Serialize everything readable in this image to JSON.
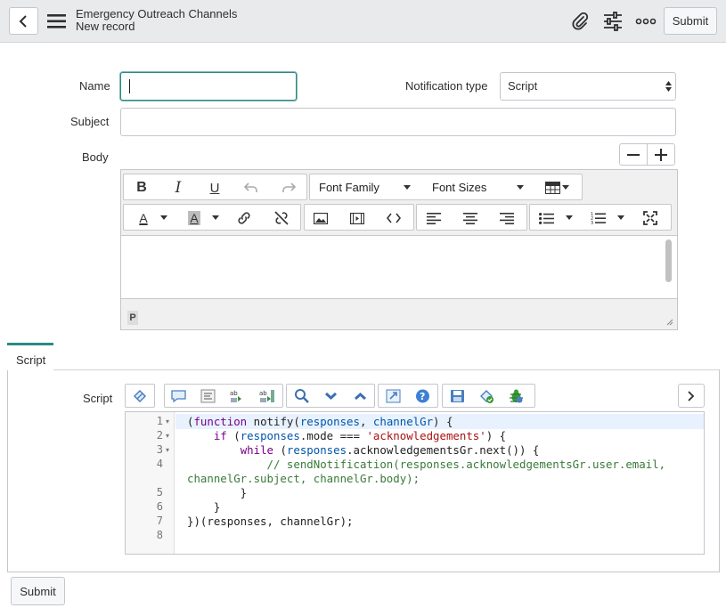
{
  "header": {
    "back_icon": "chevron-left-icon",
    "menu_icon": "hamburger-icon",
    "title": "Emergency Outreach Channels",
    "subtitle": "New record",
    "icons": [
      "paperclip-icon",
      "sliders-icon",
      "more-icon"
    ],
    "submit_label": "Submit"
  },
  "form": {
    "name_label": "Name",
    "name_value": "",
    "notification_type_label": "Notification type",
    "notification_type_value": "Script",
    "subject_label": "Subject",
    "subject_value": "",
    "body_label": "Body",
    "collapse_symbol": "−",
    "expand_symbol": "+"
  },
  "editor": {
    "font_family_label": "Font Family",
    "font_sizes_label": "Font Sizes",
    "path_element": "P",
    "content": ""
  },
  "script_section": {
    "tab_label": "Script",
    "field_label": "Script",
    "code_lines": [
      {
        "num": "1",
        "fold": true
      },
      {
        "num": "2",
        "fold": true
      },
      {
        "num": "3",
        "fold": true
      },
      {
        "num": "4",
        "fold": false
      },
      {
        "num": "5",
        "fold": false
      },
      {
        "num": "6",
        "fold": false
      },
      {
        "num": "7",
        "fold": false
      },
      {
        "num": "8",
        "fold": false
      }
    ],
    "code": {
      "l1a": "(",
      "l1kw": "function",
      "l1b": " notify(",
      "l1v1": "responses",
      "l1c": ", ",
      "l1v2": "channelGr",
      "l1d": ") {",
      "l2a": "    ",
      "l2kw": "if",
      "l2b": " (",
      "l2v": "responses",
      "l2c": ".mode === ",
      "l2s": "'acknowledgements'",
      "l2d": ") {",
      "l3a": "        ",
      "l3kw": "while",
      "l3b": " (",
      "l3v": "responses",
      "l3c": ".acknowledgementsGr.next()) {",
      "l4": "            // sendNotification(responses.acknowledgementsGr.user.email,",
      "l4b": "channelGr.subject, channelGr.body);",
      "l5": "        }",
      "l6": "    }",
      "l7": "})(responses, channelGr);"
    }
  },
  "footer": {
    "submit_label": "Submit"
  }
}
